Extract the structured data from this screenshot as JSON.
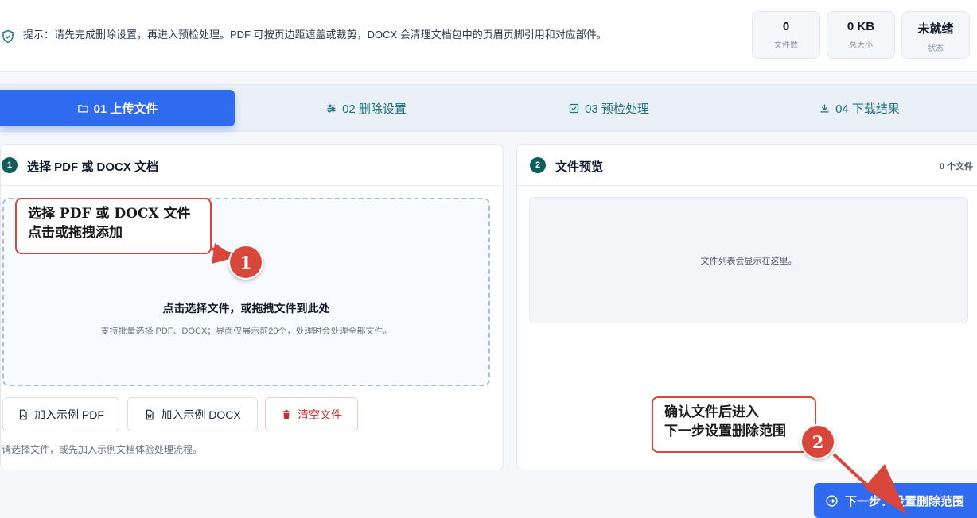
{
  "hint": {
    "icon": "shield-check-icon",
    "text": "提示：请先完成删除设置，再进入预检处理。PDF 可按页边距遮盖或裁剪，DOCX 会清理文档包中的页眉页脚引用和对应部件。"
  },
  "stats": [
    {
      "value": "0",
      "label": "文件数"
    },
    {
      "value": "0 KB",
      "label": "总大小"
    },
    {
      "value": "未就绪",
      "label": "状态"
    }
  ],
  "tabs": [
    {
      "label": "01 上传文件",
      "icon": "folder-icon",
      "active": true
    },
    {
      "label": "02 删除设置",
      "icon": "sliders-icon",
      "active": false
    },
    {
      "label": "03 预检处理",
      "icon": "checkbox-icon",
      "active": false
    },
    {
      "label": "04 下载结果",
      "icon": "download-icon",
      "active": false
    }
  ],
  "upload_panel": {
    "step": "1",
    "title": "选择 PDF 或 DOCX 文档",
    "dropzone_title": "点击选择文件，或拖拽文件到此处",
    "dropzone_sub": "支持批量选择 PDF、DOCX；界面仅展示前20个，处理时会处理全部文件。",
    "buttons": {
      "add_pdf": "加入示例 PDF",
      "add_docx": "加入示例 DOCX",
      "clear": "清空文件"
    },
    "helper": "请选择文件，或先加入示例文档体验处理流程。"
  },
  "preview_panel": {
    "step": "2",
    "title": "文件预览",
    "count": "0 个文件",
    "empty_text": "文件列表会显示在这里。"
  },
  "next_button": "下一步：设置删除范围",
  "annotations": {
    "callout1": {
      "line1": "选择 PDF 或 DOCX 文件",
      "line2": "点击或拖拽添加"
    },
    "badge1": "1",
    "callout2": {
      "line1": "确认文件后进入",
      "line2": "下一步设置删除范围"
    },
    "badge2": "2",
    "accent": "#d9463b"
  },
  "colors": {
    "primary": "#2f6bf0",
    "teal": "#0f5e5f",
    "danger": "#d12d2d"
  }
}
